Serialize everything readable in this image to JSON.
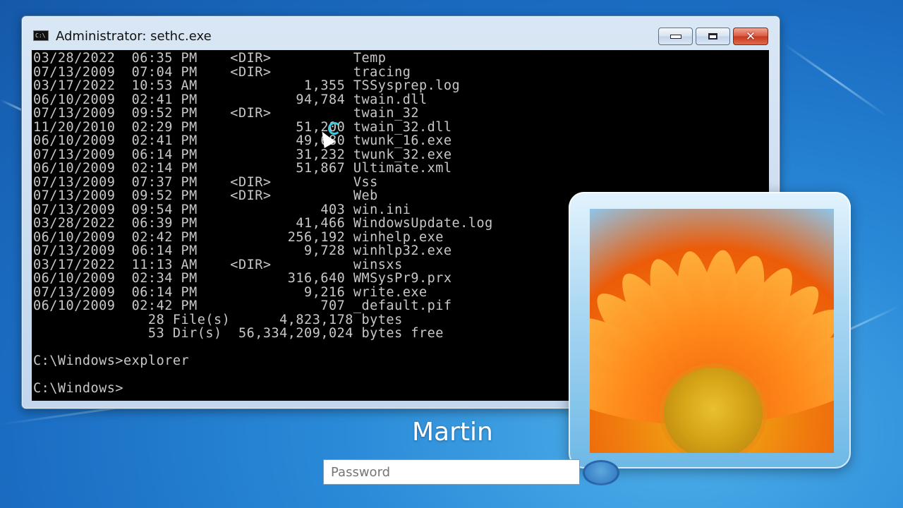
{
  "window": {
    "title": "Administrator: sethc.exe",
    "icon_label": "C:\\",
    "controls": {
      "minimize": "minimize-icon",
      "maximize": "maximize-icon",
      "close": "✕"
    }
  },
  "console": {
    "lines": [
      "03/28/2022  06:35 PM    <DIR>          Temp",
      "07/13/2009  07:04 PM    <DIR>          tracing",
      "03/17/2022  10:53 AM             1,355 TSSysprep.log",
      "06/10/2009  02:41 PM            94,784 twain.dll",
      "07/13/2009  09:52 PM    <DIR>          twain_32",
      "11/20/2010  02:29 PM            51,200 twain_32.dll",
      "06/10/2009  02:41 PM            49,680 twunk_16.exe",
      "07/13/2009  06:14 PM            31,232 twunk_32.exe",
      "06/10/2009  02:14 PM            51,867 Ultimate.xml",
      "07/13/2009  07:37 PM    <DIR>          Vss",
      "07/13/2009  09:52 PM    <DIR>          Web",
      "07/13/2009  09:54 PM               403 win.ini",
      "03/28/2022  06:39 PM            41,466 WindowsUpdate.log",
      "06/10/2009  02:42 PM           256,192 winhelp.exe",
      "07/13/2009  06:14 PM             9,728 winhlp32.exe",
      "03/17/2022  11:13 AM    <DIR>          winsxs",
      "06/10/2009  02:34 PM           316,640 WMSysPr9.prx",
      "07/13/2009  06:14 PM             9,216 write.exe",
      "06/10/2009  02:42 PM               707 _default.pif",
      "              28 File(s)      4,823,178 bytes",
      "              53 Dir(s)  56,334,209,024 bytes free",
      "",
      "C:\\Windows>explorer",
      "",
      "C:\\Windows>"
    ]
  },
  "login": {
    "username": "Martin",
    "password_placeholder": "Password",
    "password_value": ""
  }
}
